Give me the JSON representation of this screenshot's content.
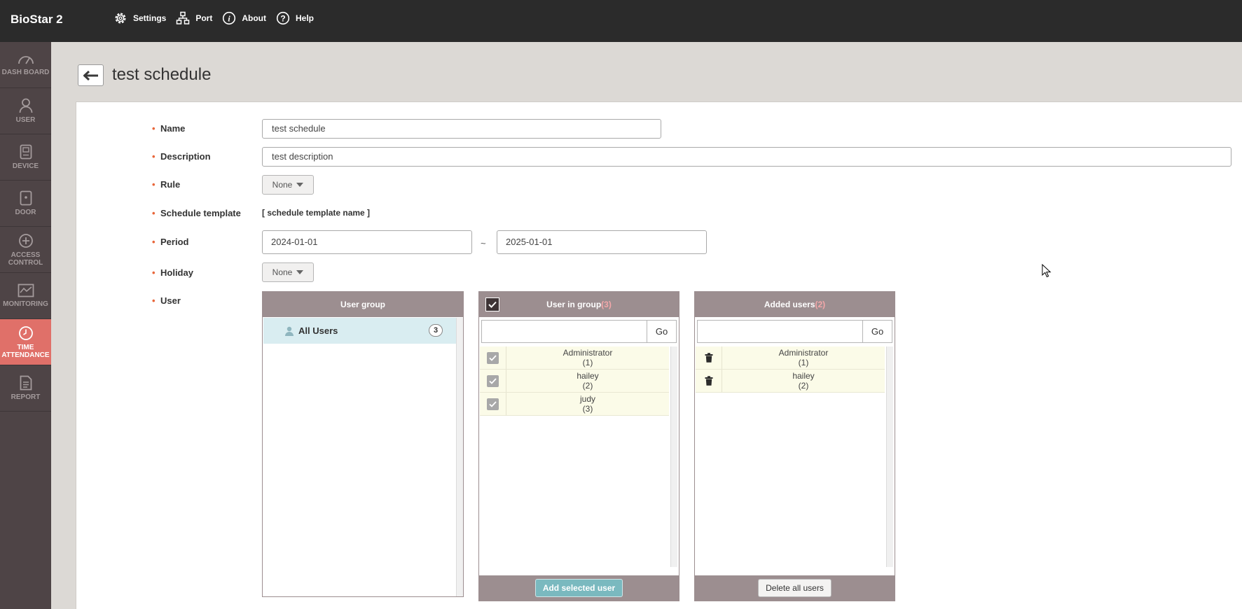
{
  "app": {
    "brand": "BioStar 2"
  },
  "topnav": [
    {
      "label": "Settings",
      "icon": "gear-icon"
    },
    {
      "label": "Port",
      "icon": "network-icon"
    },
    {
      "label": "About",
      "icon": "info-icon"
    },
    {
      "label": "Help",
      "icon": "help-icon"
    }
  ],
  "sidebar": [
    {
      "label": "DASH BOARD",
      "icon": "dashboard-icon",
      "active": false
    },
    {
      "label": "USER",
      "icon": "user-icon",
      "active": false
    },
    {
      "label": "DEVICE",
      "icon": "device-icon",
      "active": false
    },
    {
      "label": "DOOR",
      "icon": "door-icon",
      "active": false
    },
    {
      "label": "ACCESS CONTROL",
      "icon": "access-control-icon",
      "active": false
    },
    {
      "label": "MONITORING",
      "icon": "monitoring-icon",
      "active": false
    },
    {
      "label": "TIME ATTENDANCE",
      "icon": "clock-icon",
      "active": true
    },
    {
      "label": "REPORT",
      "icon": "report-icon",
      "active": false
    }
  ],
  "page": {
    "title": "test schedule"
  },
  "form": {
    "name_label": "Name",
    "name_value": "test schedule",
    "description_label": "Description",
    "description_value": "test description",
    "rule_label": "Rule",
    "rule_value": "None",
    "template_label": "Schedule template",
    "template_value": "[ schedule template name ]",
    "period_label": "Period",
    "period_start": "2024-01-01",
    "period_separator": "~",
    "period_end": "2025-01-01",
    "holiday_label": "Holiday",
    "holiday_value": "None",
    "user_label": "User"
  },
  "user_group": {
    "title": "User group",
    "groups": [
      {
        "name": "All Users",
        "count": "3"
      }
    ]
  },
  "user_in_group": {
    "title": "User in group",
    "count": "(3)",
    "go_label": "Go",
    "users": [
      {
        "name": "Administrator",
        "id": "(1)",
        "checked": true
      },
      {
        "name": "hailey",
        "id": "(2)",
        "checked": true
      },
      {
        "name": "judy",
        "id": "(3)",
        "checked": true
      }
    ],
    "action_label": "Add selected user"
  },
  "added_users": {
    "title": "Added users",
    "count": "(2)",
    "go_label": "Go",
    "users": [
      {
        "name": "Administrator",
        "id": "(1)"
      },
      {
        "name": "hailey",
        "id": "(2)"
      }
    ],
    "action_label": "Delete all users"
  },
  "colors": {
    "topbar": "#2b2b2b",
    "sidebar": "#4e4446",
    "sidebar_active": "#e07069",
    "box_header": "#9c8e90",
    "accent_teal": "#7ab9bf",
    "required_dot": "#e8663a"
  }
}
